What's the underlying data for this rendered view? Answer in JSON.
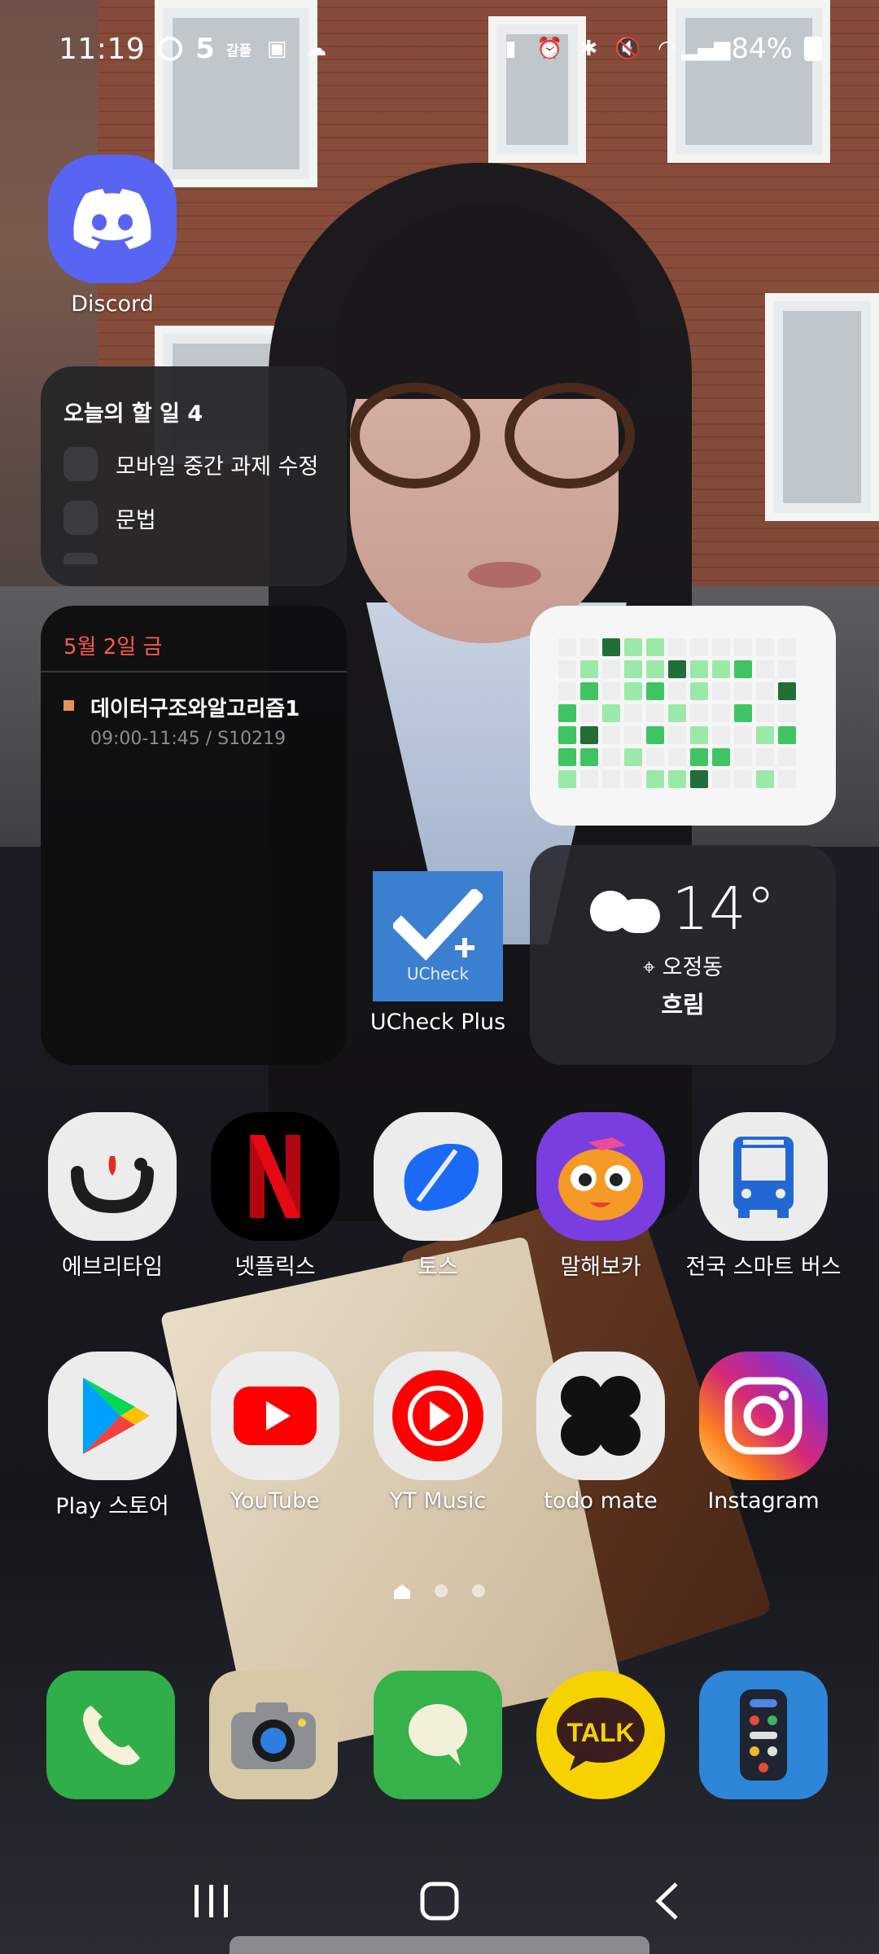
{
  "status_bar": {
    "time": "11:19",
    "notif_count": "5",
    "small_badge": "갈플",
    "battery": "84%"
  },
  "apps": {
    "discord": {
      "label": "Discord",
      "color": "#5865f2",
      "icon": "discord-icon"
    },
    "ucheck": {
      "label": "UCheck Plus",
      "inner": "UCheck",
      "color": "#3b7fd1",
      "icon": "check-icon"
    },
    "row1": [
      {
        "label": "에브리타임",
        "icon": "everytime-icon",
        "color": "#ececec"
      },
      {
        "label": "넷플릭스",
        "icon": "netflix-icon",
        "color": "#000000"
      },
      {
        "label": "토스",
        "icon": "toss-icon",
        "color": "#ececec"
      },
      {
        "label": "말해보카",
        "icon": "malhaevoca-icon",
        "color": "#7a3de0"
      },
      {
        "label": "전국 스마트 버스",
        "icon": "bus-icon",
        "color": "#ececec"
      }
    ],
    "row2": [
      {
        "label": "Play 스토어",
        "icon": "play-store-icon",
        "color": "#ececec"
      },
      {
        "label": "YouTube",
        "icon": "youtube-icon",
        "color": "#ececec"
      },
      {
        "label": "YT Music",
        "icon": "yt-music-icon",
        "color": "#ececec"
      },
      {
        "label": "todo mate",
        "icon": "todo-mate-icon",
        "color": "#ececec"
      },
      {
        "label": "Instagram",
        "icon": "instagram-icon",
        "color": "#d62976"
      }
    ],
    "dock": [
      {
        "icon": "phone-icon",
        "color": "#2fae4a"
      },
      {
        "icon": "camera-icon",
        "color": "#d8c9a6"
      },
      {
        "icon": "messages-icon",
        "color": "#35b24a"
      },
      {
        "label": "TALK",
        "icon": "kakaotalk-icon",
        "color": "#f5d200"
      },
      {
        "icon": "remote-icon",
        "color": "#2d86d8"
      }
    ]
  },
  "todo_widget": {
    "title": "오늘의 할 일 4",
    "items": [
      "모바일 중간 과제 수정",
      "문법"
    ]
  },
  "calendar_widget": {
    "date": "5월 2일 금",
    "event_title": "데이터구조와알고리즘1",
    "event_detail": "09:00-11:45 / S10219",
    "event_color": "#e7925a"
  },
  "grass_widget": {
    "levels": [
      [
        0,
        0,
        3,
        1,
        1,
        0,
        0,
        0,
        0,
        0,
        0
      ],
      [
        0,
        1,
        0,
        1,
        1,
        3,
        1,
        1,
        2,
        0,
        0
      ],
      [
        0,
        2,
        0,
        1,
        2,
        0,
        1,
        0,
        0,
        0,
        3
      ],
      [
        2,
        0,
        1,
        0,
        0,
        1,
        0,
        0,
        2,
        0,
        0
      ],
      [
        2,
        3,
        0,
        0,
        2,
        0,
        1,
        0,
        0,
        1,
        2
      ],
      [
        2,
        2,
        0,
        1,
        0,
        0,
        2,
        2,
        0,
        0,
        0
      ],
      [
        1,
        0,
        0,
        0,
        1,
        1,
        3,
        0,
        0,
        1,
        0
      ]
    ],
    "colors": [
      "#ededed",
      "#9be9a8",
      "#40c463",
      "#216e39"
    ]
  },
  "weather_widget": {
    "temp": "14°",
    "location": "오정동",
    "condition": "흐림"
  }
}
